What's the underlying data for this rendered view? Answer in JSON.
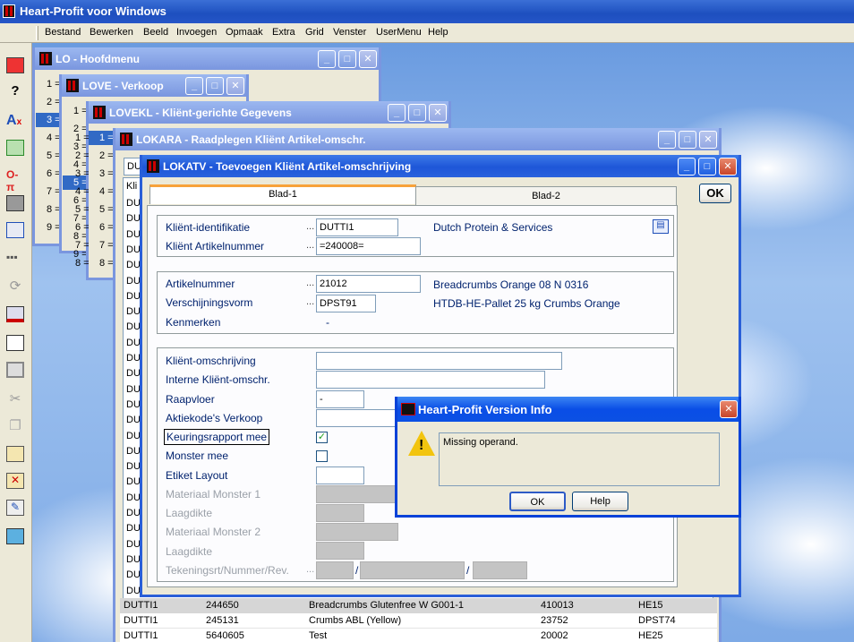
{
  "app": {
    "title": "Heart-Profit voor Windows"
  },
  "menu": [
    "Bestand",
    "Bewerken",
    "Beeld",
    "Invoegen",
    "Opmaak",
    "Extra",
    "Grid",
    "Venster",
    "UserMenu",
    "Help"
  ],
  "toolbar": [
    "report-icon",
    "help-icon",
    "font-icon",
    "export-icon",
    "key-icon",
    "print-icon",
    "window-icon",
    "dots-icon",
    "refresh-icon",
    "card-icon",
    "chart-icon",
    "form-icon",
    "cut-icon",
    "copy-icon",
    "paste-icon",
    "clipboard-delete-icon",
    "edit-icon",
    "screen-icon"
  ],
  "windows": {
    "lo": {
      "title": "LO - Hoofdmenu",
      "items": [
        "1 =",
        "2 =",
        "3 =",
        "4 =",
        "5 =",
        "6 =",
        "7 =",
        "8 =",
        "9 ="
      ]
    },
    "love": {
      "title": "LOVE - Verkoop",
      "items": [
        "1 =",
        "2 =",
        "3 =",
        "4 =",
        "5 =",
        "6 =",
        "7 =",
        "8 =",
        "9 ="
      ]
    },
    "lovekl": {
      "title": "LOVEKL - Kliënt-gerichte Gegevens",
      "items": [
        "1 =",
        "2 =",
        "3 =",
        "4 =",
        "5 =",
        "6 =",
        "7 =",
        "8 ="
      ]
    },
    "lokara": {
      "title": "LOKARA - Raadplegen Kliënt Artikel-omschr.",
      "search": "DU",
      "col_header": "Kli",
      "row_prefix": "DU",
      "visible_rows": [
        {
          "c1": "DUTTI1",
          "c2": "244650",
          "c3": "Breadcrumbs Glutenfree W G001-1",
          "c4": "410013",
          "c5": "HE15"
        },
        {
          "c1": "DUTTI1",
          "c2": "245131",
          "c3": "Crumbs ABL (Yellow)",
          "c4": "23752",
          "c5": "DPST74"
        },
        {
          "c1": "DUTTI1",
          "c2": "5640605",
          "c3": "Test",
          "c4": "20002",
          "c5": "HE25"
        }
      ]
    },
    "lokatv": {
      "title": "LOKATV - Toevoegen Kliënt Artikel-omschrijving",
      "ok_label": "OK",
      "tabs": [
        "Blad-1",
        "Blad-2"
      ],
      "group1": {
        "klient_id_label": "Kliënt-identifikatie",
        "klient_id_value": "DUTTI1",
        "klient_art_label": "Kliënt Artikelnummer",
        "klient_art_value": "=240008=",
        "klient_name": "Dutch Protein & Services"
      },
      "group2": {
        "artnr_label": "Artikelnummer",
        "artnr_value": "21012",
        "artnr_desc": "Breadcrumbs Orange 08 N 0316",
        "vorm_label": "Verschijningsvorm",
        "vorm_value": "DPST91",
        "vorm_desc": "HTDB-HE-Pallet 25 kg Crumbs Orange",
        "kenmerken_label": "Kenmerken",
        "kenmerken_value": "-"
      },
      "group3": {
        "omschr_label": "Kliënt-omschrijving",
        "intern_label": "Interne Kliënt-omschr.",
        "raap_label": "Raapvloer",
        "raap_value": "-",
        "aktie_label": "Aktiekode's Verkoop",
        "keur_label": "Keuringsrapport mee",
        "keur_checked": "✓",
        "monster_label": "Monster mee",
        "etiket_label": "Etiket Layout",
        "mat1_label": "Materiaal Monster 1",
        "laag1_label": "Laagdikte",
        "mat2_label": "Materiaal Monster 2",
        "laag2_label": "Laagdikte",
        "teken_label": "Tekeningsrt/Nummer/Rev.",
        "sep": "/"
      }
    }
  },
  "dialog": {
    "title": "Heart-Profit Version Info",
    "message": "Missing operand.",
    "ok_label": "OK",
    "help_label": "Help",
    "icon": "warning-icon"
  }
}
